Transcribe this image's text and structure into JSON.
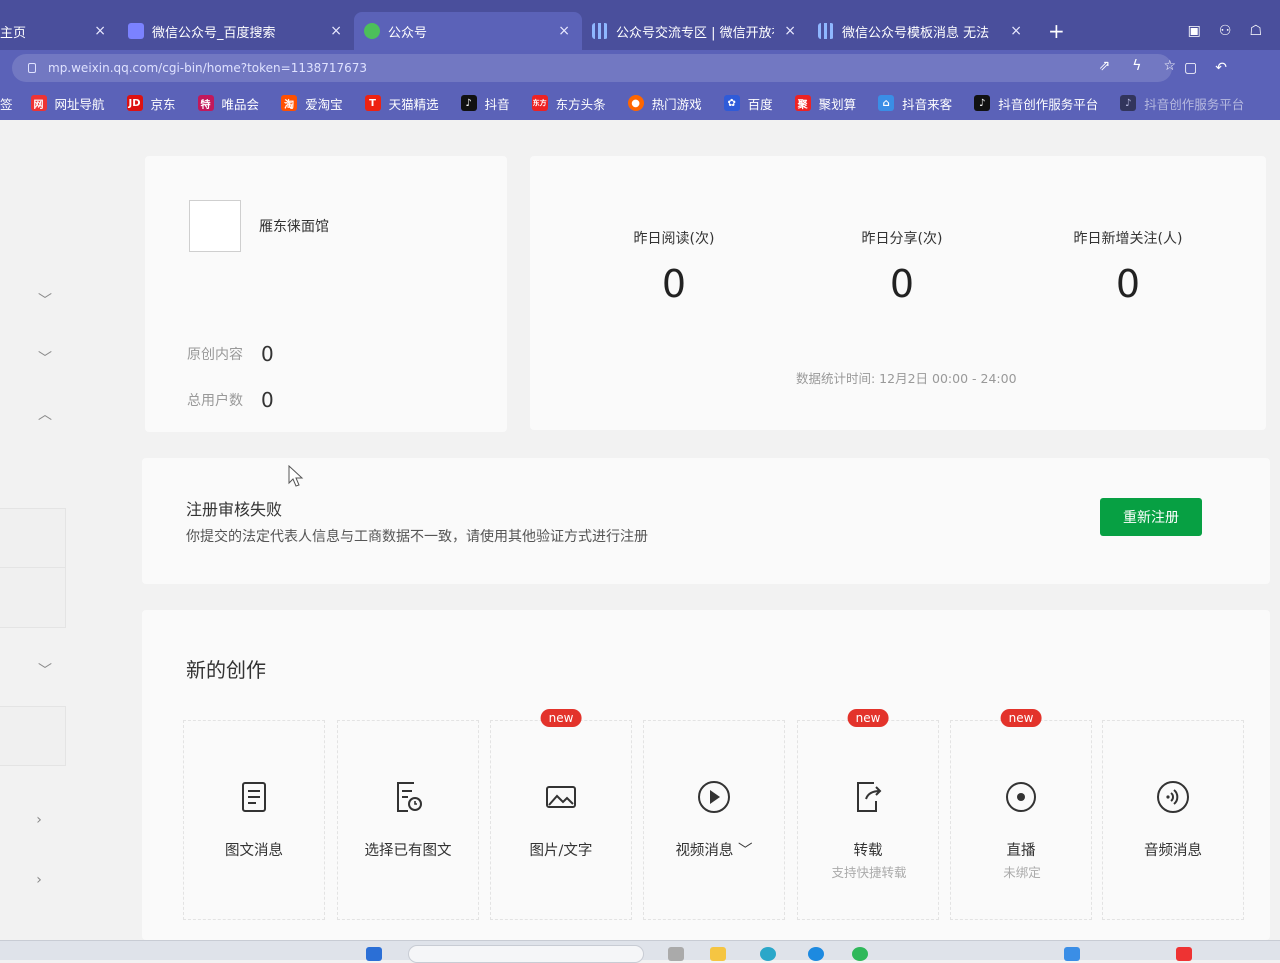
{
  "browser": {
    "tabs": [
      {
        "label": "主页",
        "active": false,
        "icon": "home-icon"
      },
      {
        "label": "微信公众号_百度搜索",
        "active": false,
        "icon": "baidu-icon"
      },
      {
        "label": "公众号",
        "active": true,
        "icon": "wechat-icon"
      },
      {
        "label": "公众号交流专区 | 微信开放社",
        "active": false,
        "icon": "grid-icon"
      },
      {
        "label": "微信公众号模板消息 无法",
        "active": false,
        "icon": "grid-icon"
      }
    ],
    "close_glyph": "×",
    "new_tab_glyph": "+",
    "url": "mp.weixin.qq.com/cgi-bin/home?token=1138717673",
    "bookmarks": [
      {
        "label": "签",
        "icon": ""
      },
      {
        "label": "网址导航",
        "icon": "网"
      },
      {
        "label": "京东",
        "icon": "JD"
      },
      {
        "label": "唯品会",
        "icon": "特"
      },
      {
        "label": "爱淘宝",
        "icon": "淘"
      },
      {
        "label": "天猫精选",
        "icon": "T"
      },
      {
        "label": "抖音",
        "icon": "♪"
      },
      {
        "label": "东方头条",
        "icon": "东方"
      },
      {
        "label": "热门游戏",
        "icon": "●"
      },
      {
        "label": "百度",
        "icon": "✿"
      },
      {
        "label": "聚划算",
        "icon": "聚"
      },
      {
        "label": "抖音来客",
        "icon": "⌂"
      },
      {
        "label": "抖音创作服务平台",
        "icon": "♪"
      },
      {
        "label": "抖音创作服务平台",
        "icon": "♪"
      }
    ]
  },
  "account": {
    "name": "雁东徕面馆",
    "original_label": "原创内容",
    "original_value": "0",
    "users_label": "总用户数",
    "users_value": "0"
  },
  "stats": {
    "items": [
      {
        "label": "昨日阅读(次)",
        "value": "0"
      },
      {
        "label": "昨日分享(次)",
        "value": "0"
      },
      {
        "label": "昨日新增关注(人)",
        "value": "0"
      }
    ],
    "time_text": "数据统计时间: 12月2日 00:00 - 24:00"
  },
  "notice": {
    "title": "注册审核失败",
    "description": "你提交的法定代表人信息与工商数据不一致，请使用其他验证方式进行注册",
    "button_label": "重新注册",
    "button_color": "#07a043"
  },
  "creation": {
    "title": "新的创作",
    "badge_text": "new",
    "items": [
      {
        "label": "图文消息",
        "icon": "document-icon",
        "new": false,
        "sub": ""
      },
      {
        "label": "选择已有图文",
        "icon": "document-clock-icon",
        "new": false,
        "sub": ""
      },
      {
        "label": "图片/文字",
        "icon": "image-icon",
        "new": true,
        "sub": ""
      },
      {
        "label": "视频消息 ﹀",
        "icon": "play-icon",
        "new": false,
        "sub": ""
      },
      {
        "label": "转载",
        "icon": "share-doc-icon",
        "new": true,
        "sub": "支持快捷转载"
      },
      {
        "label": "直播",
        "icon": "live-icon",
        "new": true,
        "sub": "未绑定"
      },
      {
        "label": "音频消息",
        "icon": "audio-icon",
        "new": false,
        "sub": ""
      }
    ]
  }
}
